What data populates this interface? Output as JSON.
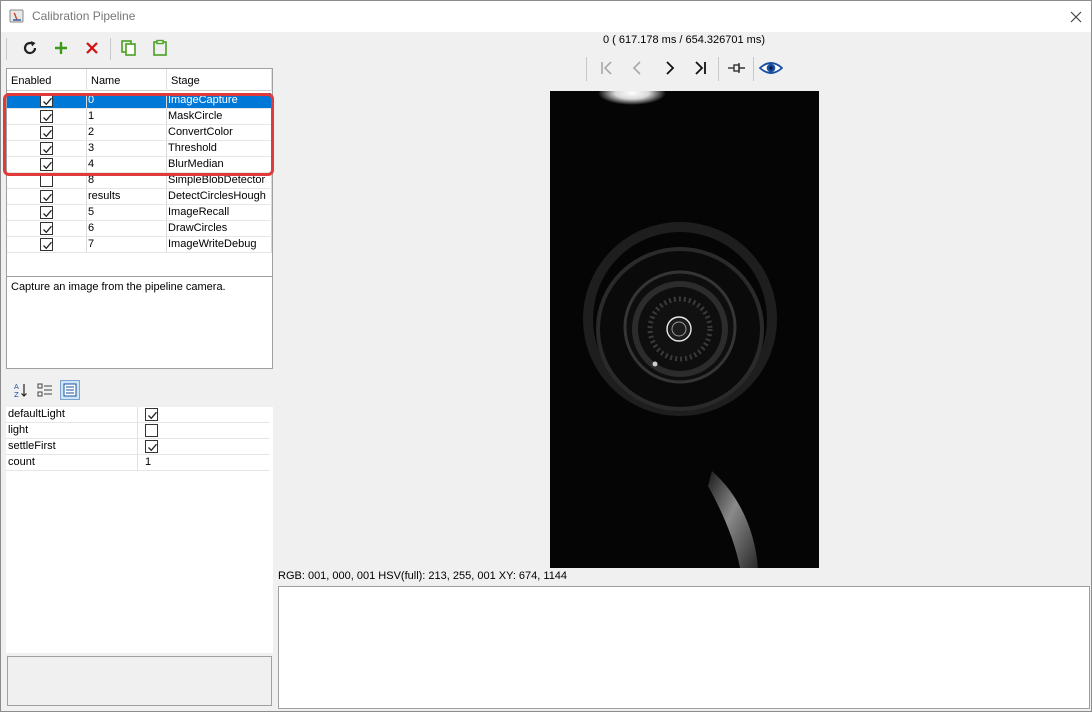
{
  "window": {
    "title": "Calibration Pipeline"
  },
  "toolbar": {
    "buttons": [
      "refresh-icon",
      "add-icon",
      "delete-icon",
      "copy-icon",
      "paste-icon"
    ]
  },
  "table": {
    "headers": {
      "enabled": "Enabled",
      "name": "Name",
      "stage": "Stage"
    },
    "rows": [
      {
        "enabled": true,
        "name": "0",
        "stage": "ImageCapture",
        "selected": true
      },
      {
        "enabled": true,
        "name": "1",
        "stage": "MaskCircle"
      },
      {
        "enabled": true,
        "name": "2",
        "stage": "ConvertColor"
      },
      {
        "enabled": true,
        "name": "3",
        "stage": "Threshold"
      },
      {
        "enabled": true,
        "name": "4",
        "stage": "BlurMedian"
      },
      {
        "enabled": false,
        "name": "8",
        "stage": "SimpleBlobDetector"
      },
      {
        "enabled": true,
        "name": "results",
        "stage": "DetectCirclesHough"
      },
      {
        "enabled": true,
        "name": "5",
        "stage": "ImageRecall"
      },
      {
        "enabled": true,
        "name": "6",
        "stage": "DrawCircles"
      },
      {
        "enabled": true,
        "name": "7",
        "stage": "ImageWriteDebug"
      }
    ]
  },
  "description": "Capture an image from the pipeline camera.",
  "properties": [
    {
      "name": "defaultLight",
      "type": "bool",
      "value": true
    },
    {
      "name": "light",
      "type": "bool",
      "value": false
    },
    {
      "name": "settleFirst",
      "type": "bool",
      "value": true
    },
    {
      "name": "count",
      "type": "text",
      "value": "1"
    }
  ],
  "viewer": {
    "time": "0 ( 617.178 ms / 654.326701 ms)",
    "status": "RGB: 001, 000, 001 HSV(full): 213, 255, 001 XY: 674, 1144"
  },
  "colors": {
    "selection": "#0078d7",
    "highlight": "#e03a3a",
    "add": "#3a9a1a",
    "delete": "#d01010",
    "clip": "#4aa020",
    "eye": "#1a4fa0"
  }
}
